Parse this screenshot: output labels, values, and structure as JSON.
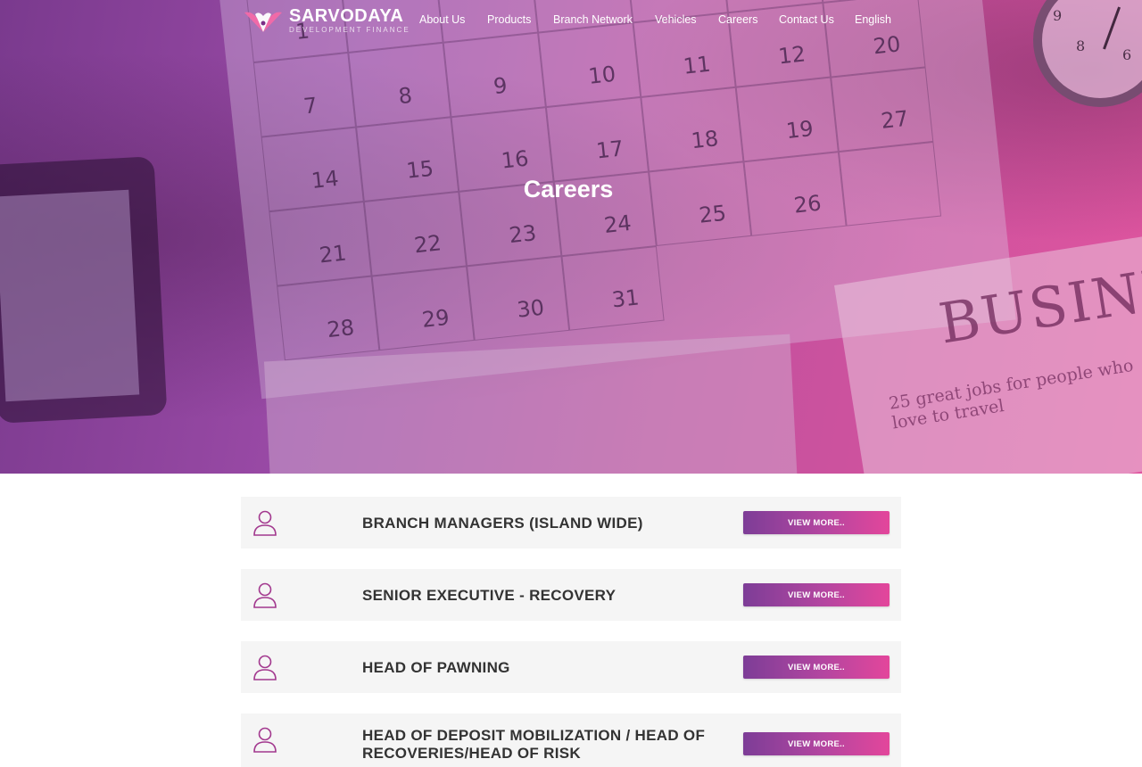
{
  "brand": {
    "name": "SARVODAYA",
    "tagline": "DEVELOPMENT FINANCE"
  },
  "nav": {
    "items": [
      {
        "label": "About Us"
      },
      {
        "label": "Products"
      },
      {
        "label": "Branch Network"
      },
      {
        "label": "Vehicles"
      },
      {
        "label": "Careers"
      },
      {
        "label": "Contact Us"
      },
      {
        "label": "English"
      }
    ]
  },
  "hero": {
    "title": "Careers",
    "newspaper_headline": "BUSINE",
    "newspaper_subtext": "25 great jobs for people who love to travel"
  },
  "calendar": {
    "days": [
      "1",
      "",
      "",
      "",
      "",
      "",
      "",
      "7",
      "8",
      "9",
      "10",
      "11",
      "12",
      "20",
      "14",
      "15",
      "16",
      "17",
      "18",
      "19",
      "27",
      "21",
      "22",
      "23",
      "24",
      "25",
      "26",
      "",
      "28",
      "29",
      "30",
      "31"
    ]
  },
  "jobs": [
    {
      "title": "BRANCH MANAGERS (ISLAND WIDE)",
      "button": "VIEW MORE.."
    },
    {
      "title": "SENIOR EXECUTIVE - RECOVERY",
      "button": "VIEW MORE.."
    },
    {
      "title": "HEAD OF PAWNING",
      "button": "VIEW MORE.."
    },
    {
      "title": "HEAD OF DEPOSIT MOBILIZATION / HEAD OF RECOVERIES/HEAD OF RISK",
      "button": "VIEW MORE.."
    }
  ],
  "colors": {
    "accent_start": "#7d3d97",
    "accent_end": "#e3469b",
    "icon": "#a2388e",
    "row_bg": "#f5f5f5"
  }
}
